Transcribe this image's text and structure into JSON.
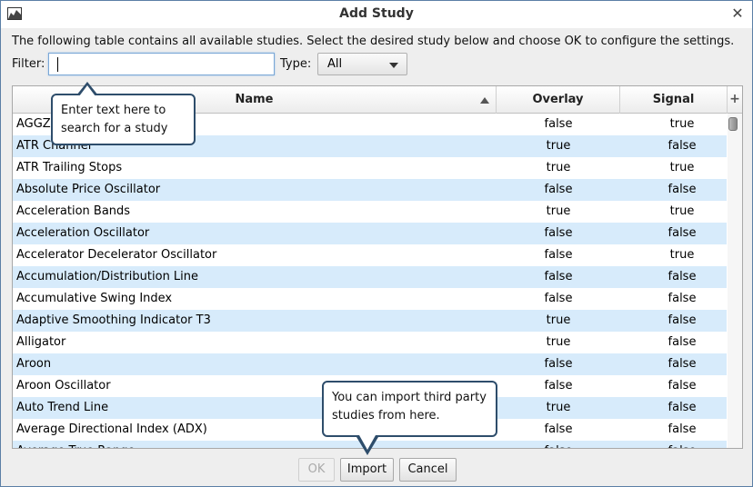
{
  "window": {
    "title": "Add Study"
  },
  "description": "The following table contains all available studies.  Select the desired study below and choose OK to configure the settings.",
  "filter": {
    "label": "Filter:",
    "value": ""
  },
  "type_select": {
    "label": "Type:",
    "value": "All"
  },
  "table": {
    "columns": {
      "name": "Name",
      "overlay": "Overlay",
      "signal": "Signal"
    },
    "plus": "+",
    "rows": [
      {
        "name": "AGGZ",
        "overlay": "false",
        "signal": "true"
      },
      {
        "name": "ATR Channel",
        "overlay": "true",
        "signal": "false"
      },
      {
        "name": "ATR Trailing Stops",
        "overlay": "true",
        "signal": "true"
      },
      {
        "name": "Absolute Price Oscillator",
        "overlay": "false",
        "signal": "false"
      },
      {
        "name": "Acceleration Bands",
        "overlay": "true",
        "signal": "true"
      },
      {
        "name": "Acceleration Oscillator",
        "overlay": "false",
        "signal": "false"
      },
      {
        "name": "Accelerator Decelerator Oscillator",
        "overlay": "false",
        "signal": "true"
      },
      {
        "name": "Accumulation/Distribution Line",
        "overlay": "false",
        "signal": "false"
      },
      {
        "name": "Accumulative Swing Index",
        "overlay": "false",
        "signal": "false"
      },
      {
        "name": "Adaptive Smoothing Indicator T3",
        "overlay": "true",
        "signal": "false"
      },
      {
        "name": "Alligator",
        "overlay": "true",
        "signal": "false"
      },
      {
        "name": "Aroon",
        "overlay": "false",
        "signal": "false"
      },
      {
        "name": "Aroon Oscillator",
        "overlay": "false",
        "signal": "false"
      },
      {
        "name": "Auto Trend Line",
        "overlay": "true",
        "signal": "false"
      },
      {
        "name": "Average Directional Index (ADX)",
        "overlay": "false",
        "signal": "false"
      },
      {
        "name": "Average True Range",
        "overlay": "false",
        "signal": "false"
      }
    ]
  },
  "callouts": {
    "filter": "Enter text here to search for a study",
    "import": "You can import third party studies from here."
  },
  "buttons": {
    "ok": "OK",
    "import": "Import",
    "cancel": "Cancel"
  }
}
